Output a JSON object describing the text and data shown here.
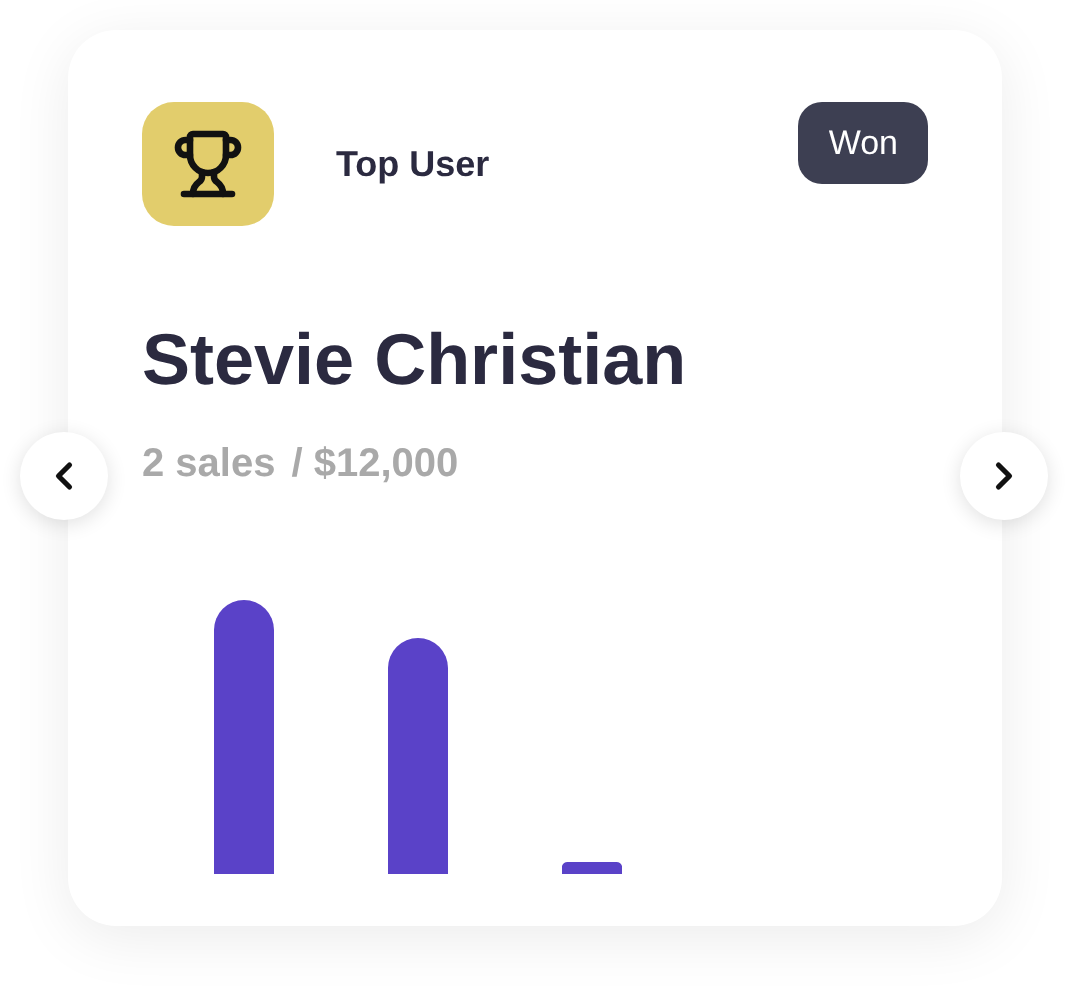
{
  "card": {
    "label": "Top User",
    "badge": "Won",
    "name": "Stevie Christian",
    "sales": "2 sales",
    "amount": "/ $12,000"
  }
}
